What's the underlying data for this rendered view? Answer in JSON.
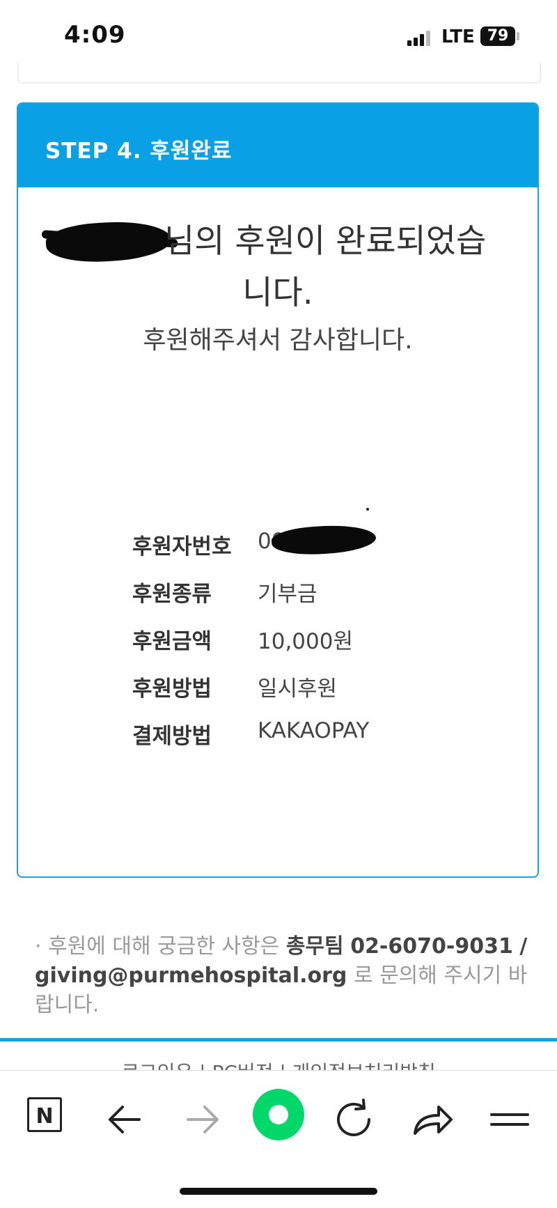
{
  "status_bar": {
    "time": "4:09",
    "network": "LTE",
    "battery": "79"
  },
  "step": {
    "title": "STEP 4. 후원완료",
    "message_line1": "님의 후원이 완료되었습",
    "message_line2": "니다.",
    "thanks": "후원해주셔서 감사합니다."
  },
  "details": [
    {
      "label": "후원자번호",
      "value": "00"
    },
    {
      "label": "후원종류",
      "value": "기부금"
    },
    {
      "label": "후원금액",
      "value": "10,000원"
    },
    {
      "label": "후원방법",
      "value": "일시후원"
    },
    {
      "label": "결제방법",
      "value": "KAKAOPAY"
    }
  ],
  "contact": {
    "prefix": "· 후원에 대해 궁금한 사항은",
    "team": "총무팀",
    "phone": "02-6070-9031",
    "separator": "/",
    "email": "giving@purmehospital.org",
    "suffix": "로 문의해 주시기 바랍니다."
  },
  "footer": {
    "links": "로그인유   |   PC버전   |   개인정보처리방침"
  },
  "toolbar": {
    "n_label": "N"
  },
  "colors": {
    "accent": "#0aa0e6",
    "browser_green": "#02d86a"
  }
}
